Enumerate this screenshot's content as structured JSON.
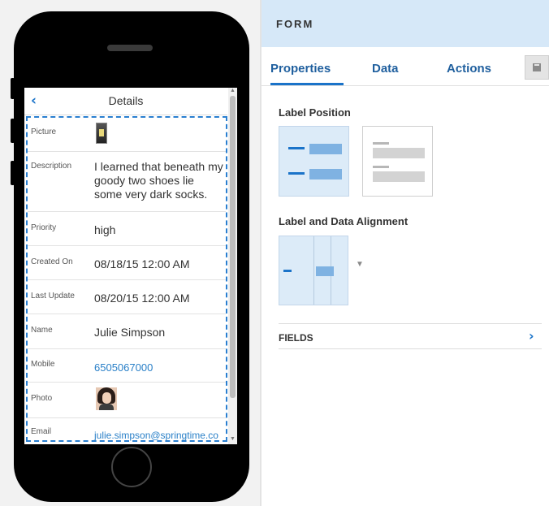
{
  "preview": {
    "screen_title": "Details",
    "back_icon": "‹",
    "fields": [
      {
        "label": "Picture",
        "type": "image",
        "icon": "picture-thumbnail"
      },
      {
        "label": "Description",
        "type": "text",
        "value": "I learned that beneath my goody two shoes lie some very dark socks."
      },
      {
        "label": "Priority",
        "type": "text",
        "value": "high"
      },
      {
        "label": "Created On",
        "type": "text",
        "value": "08/18/15 12:00 AM"
      },
      {
        "label": "Last Update",
        "type": "text",
        "value": "08/20/15 12:00 AM"
      },
      {
        "label": "Name",
        "type": "text",
        "value": "Julie Simpson"
      },
      {
        "label": "Mobile",
        "type": "link",
        "value": "6505067000"
      },
      {
        "label": "Photo",
        "type": "image",
        "icon": "user-photo"
      },
      {
        "label": "Email",
        "type": "link",
        "value": "julie.simpson@springtime.co"
      }
    ]
  },
  "panel": {
    "title": "FORM",
    "tabs": [
      "Properties",
      "Data",
      "Actions"
    ],
    "active_tab": "Properties",
    "label_position_title": "Label Position",
    "label_position_selected": "left",
    "alignment_title": "Label and Data Alignment",
    "fields_title": "FIELDS"
  },
  "colors": {
    "accent": "#1a73c9",
    "header_bg": "#d6e8f8",
    "selected_bg": "#dcebf8",
    "link": "#2a80c8"
  }
}
